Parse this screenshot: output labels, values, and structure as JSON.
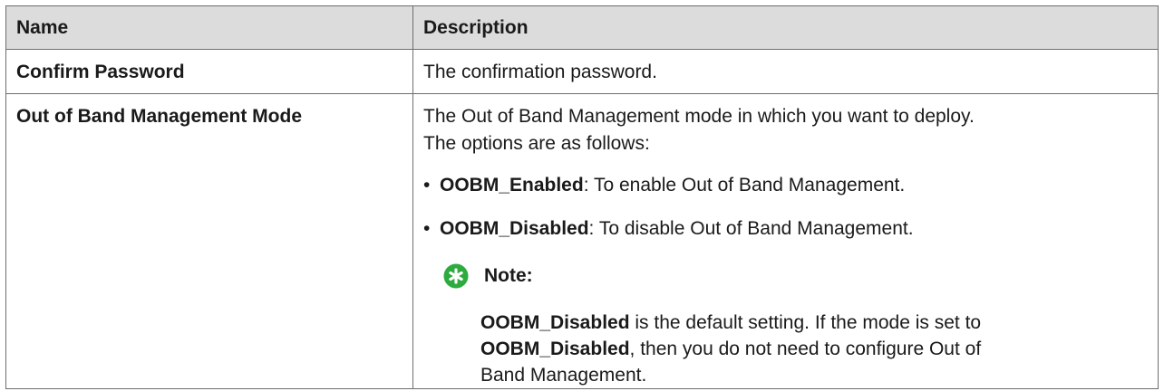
{
  "table": {
    "headers": {
      "name": "Name",
      "description": "Description"
    },
    "rows": [
      {
        "name": "Confirm Password",
        "description": "The confirmation password."
      },
      {
        "name": "Out of Band Management Mode",
        "intro_line1": "The Out of Band Management mode in which you want to deploy.",
        "intro_line2": "The options are as follows:",
        "options": [
          {
            "bullet": "•",
            "term": "OOBM_Enabled",
            "text": ": To enable Out of Band Management."
          },
          {
            "bullet": "•",
            "term": "OOBM_Disabled",
            "text": ": To disable Out of Band Management."
          }
        ],
        "note": {
          "icon": "note-star-icon",
          "icon_color": "#2dab3f",
          "label": "Note:",
          "term1": "OOBM_Disabled",
          "text1": " is the default setting. If the mode is set to",
          "term2": "OOBM_Disabled",
          "text2": ", then you do not need to configure Out of",
          "text3": "Band Management."
        }
      }
    ]
  },
  "colors": {
    "header_bg": "#dcdcdc",
    "border": "#6e6e6e",
    "note_icon": "#2dab3f"
  }
}
